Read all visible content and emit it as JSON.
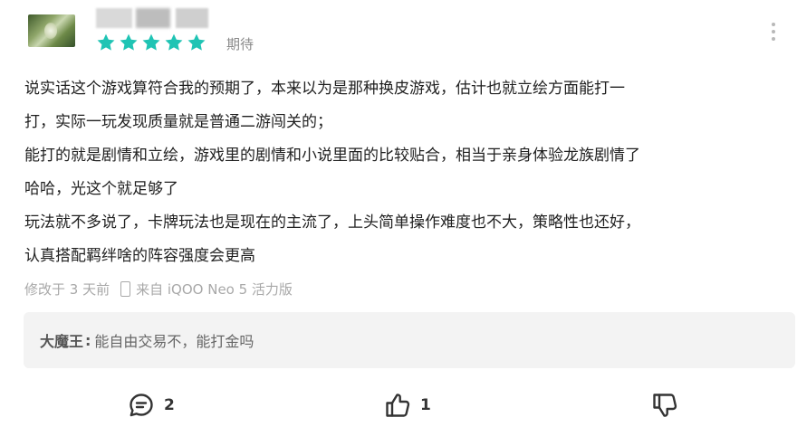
{
  "user": {
    "avatar_icon": "avatar-image",
    "username_redacted": true
  },
  "rating": {
    "stars": 5,
    "max_stars": 5,
    "star_color": "#1fc4b4",
    "label": "期待"
  },
  "review": {
    "lines": [
      "说实话这个游戏算符合我的预期了，本来以为是那种换皮游戏，估计也就立绘方面能打一",
      "打，实际一玩发现质量就是普通二游闯关的；",
      "能打的就是剧情和立绘，游戏里的剧情和小说里面的比较贴合，相当于亲身体验龙族剧情了",
      "哈哈，光这个就足够了",
      "玩法就不多说了，卡牌玩法也是现在的主流了，上头简单操作难度也不大，策略性也还好，",
      "认真搭配羁绊啥的阵容强度会更高"
    ]
  },
  "meta": {
    "edited": "修改于 3 天前",
    "device": "来自 iQOO Neo 5 活力版",
    "device_icon": "phone-icon"
  },
  "reply": {
    "author": "大魔王",
    "separator": ":",
    "text": "能自由交易不，能打金吗"
  },
  "actions": {
    "comment_icon": "comment-icon",
    "comment_count": "2",
    "like_icon": "thumbs-up-icon",
    "like_count": "1",
    "dislike_icon": "thumbs-down-icon"
  },
  "more_icon": "more-vertical-icon"
}
